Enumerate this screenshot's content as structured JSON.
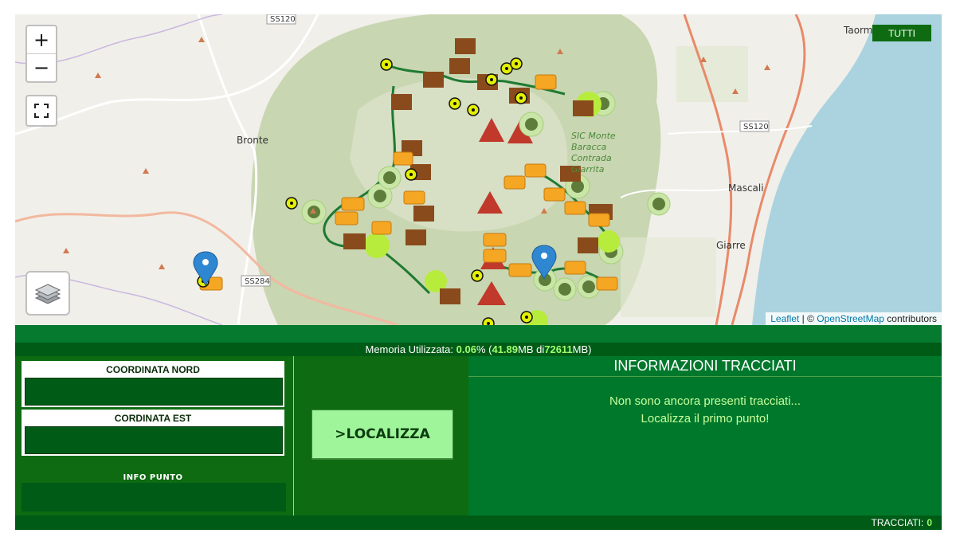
{
  "map": {
    "zoom_in": "+",
    "zoom_out": "−",
    "filter_button": "TUTTI",
    "attribution": {
      "leaflet": "Leaflet",
      "separator": " | © ",
      "osm": "OpenStreetMap",
      "suffix": " contributors"
    },
    "places": [
      "Bronte",
      "Mascali",
      "Giarre",
      "Taorm",
      "SS120",
      "SS120",
      "SS284",
      "SIC Monte Baracca Contrada Giarrita"
    ],
    "colors": {
      "park": "#c8d6b1",
      "sea": "#aad3df",
      "trail": "#1f7a32",
      "marker_pin": "#2f87d2"
    }
  },
  "memory": {
    "label": "Memoria Utilizzata:",
    "percent": "0.06",
    "pct_sign": "% (",
    "used": "41.89",
    "of": " MB di ",
    "total": "72611",
    "unit": " MB)"
  },
  "form": {
    "north_label": "COORDINATA NORD",
    "east_label": "CORDINATA EST",
    "info_label": "INFO PUNTO",
    "locate_button": ">LOCALIZZA"
  },
  "tracks": {
    "title": "INFORMAZIONI TRACCIATI",
    "empty_line1": "Non sono ancora presenti tracciati...",
    "empty_line2": "Localizza il primo punto!",
    "count_label": "TRACCIATI:",
    "count": "0"
  }
}
